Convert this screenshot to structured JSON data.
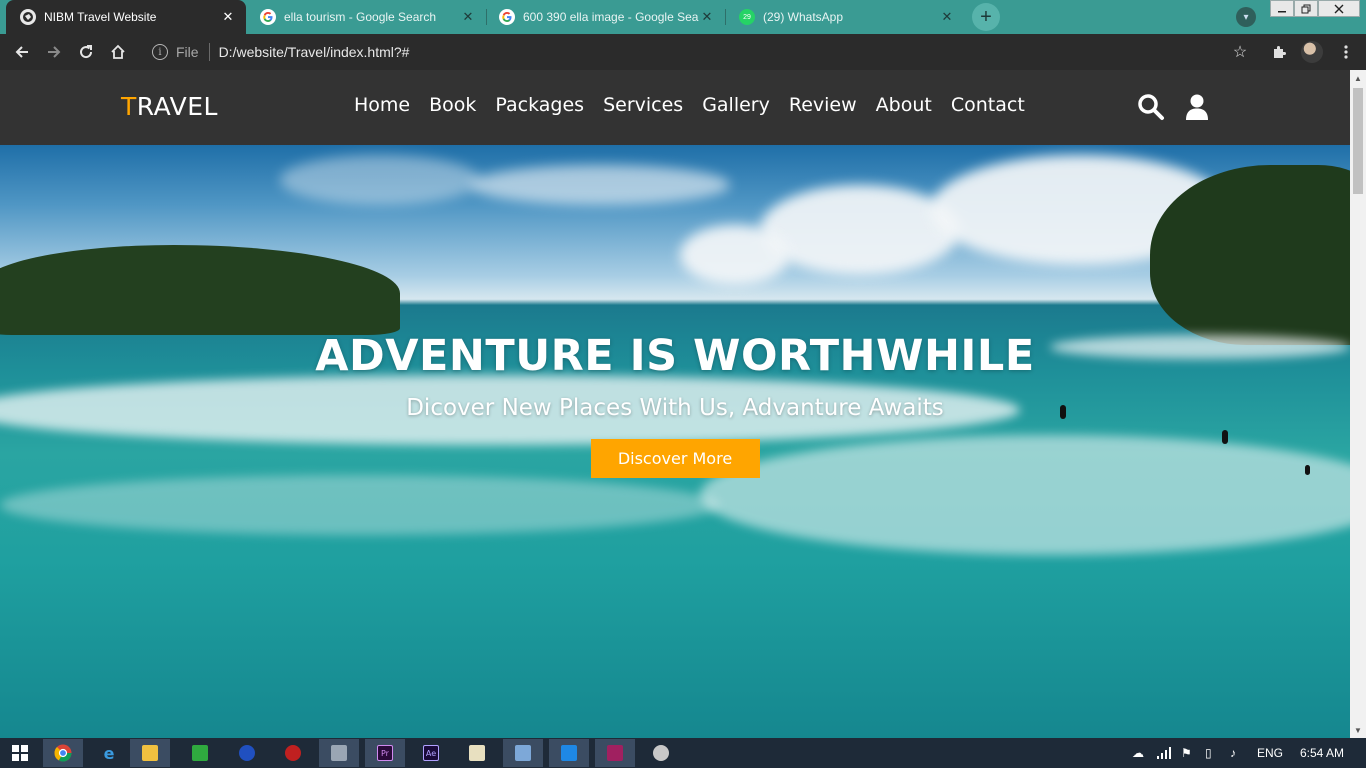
{
  "browser": {
    "tabs": [
      {
        "title": "NIBM Travel Website",
        "icon": "site-globe-icon",
        "active": true
      },
      {
        "title": "ella tourism - Google Search",
        "icon": "google-g-icon",
        "active": false
      },
      {
        "title": "600 390 ella image - Google Sea",
        "icon": "google-g-icon",
        "active": false
      },
      {
        "title": "(29) WhatsApp",
        "icon": "whatsapp-icon",
        "active": false
      }
    ],
    "new_tab_symbol": "+",
    "close_symbol": "✕",
    "address": {
      "security_label": "File",
      "url": "D:/website/Travel/index.html?#"
    },
    "colors": {
      "tabstrip": "#3a9b93",
      "toolbar": "#2b2b2b"
    }
  },
  "site": {
    "logo": {
      "first_letter": "T",
      "rest": "RAVEL",
      "accent_color": "#ffa500"
    },
    "nav": [
      "Home",
      "Book",
      "Packages",
      "Services",
      "Gallery",
      "Review",
      "About",
      "Contact"
    ],
    "icons": [
      "search-icon",
      "user-icon"
    ],
    "hero": {
      "title": "ADVENTURE IS WORTHWHILE",
      "subtitle": "Dicover New Places With Us, Advanture Awaits",
      "button": "Discover More",
      "button_color": "#ffa500"
    }
  },
  "taskbar": {
    "apps": [
      "chrome-icon",
      "internet-explorer-icon",
      "file-explorer-icon",
      "green-app-icon",
      "blue-app-icon",
      "red-app-icon",
      "app-window-icon",
      "premiere-pro-icon",
      "after-effects-icon",
      "notepad-icon",
      "virtualbox-icon",
      "vscode-icon",
      "winrar-icon",
      "extra-app-icon"
    ],
    "premiere_label": "Pr",
    "after_effects_label": "Ae",
    "tray": {
      "language": "ENG",
      "time": "6:54 AM"
    }
  }
}
